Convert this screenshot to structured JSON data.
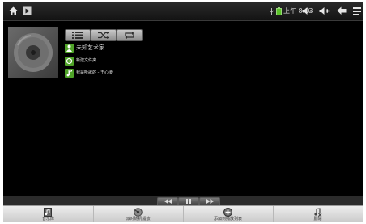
{
  "status_bar": {
    "time": "上午 8:03",
    "icons": [
      "home-icon",
      "media-player-icon",
      "usb-icon",
      "battery-icon",
      "volume-down-icon",
      "volume-up-icon",
      "back-icon",
      "menu-icon"
    ]
  },
  "album_art": {
    "icon": "disc-icon"
  },
  "play_modes": [
    {
      "name": "list-mode-button",
      "icon": "list-icon"
    },
    {
      "name": "shuffle-mode-button",
      "icon": "shuffle-icon"
    },
    {
      "name": "repeat-mode-button",
      "icon": "repeat-icon"
    }
  ],
  "track_info": {
    "artist": "未知艺术家",
    "folder": "新建文件夹",
    "title": "我是听歌的 - 王心凌"
  },
  "transport": {
    "buttons": [
      "previous-icon",
      "pause-icon",
      "next-icon"
    ]
  },
  "tabs": [
    {
      "label": "音乐库",
      "icon": "music-library-icon"
    },
    {
      "label": "派对随机播放",
      "icon": "party-shuffle-icon"
    },
    {
      "label": "添加到播放列表",
      "icon": "add-icon"
    },
    {
      "label": "删除",
      "icon": "delete-icon"
    }
  ],
  "colors": {
    "background": "#000000",
    "status_bar": "#1e1e1e",
    "accent_green": "#4fa328",
    "bottom_bar": "#d9d9d9"
  }
}
